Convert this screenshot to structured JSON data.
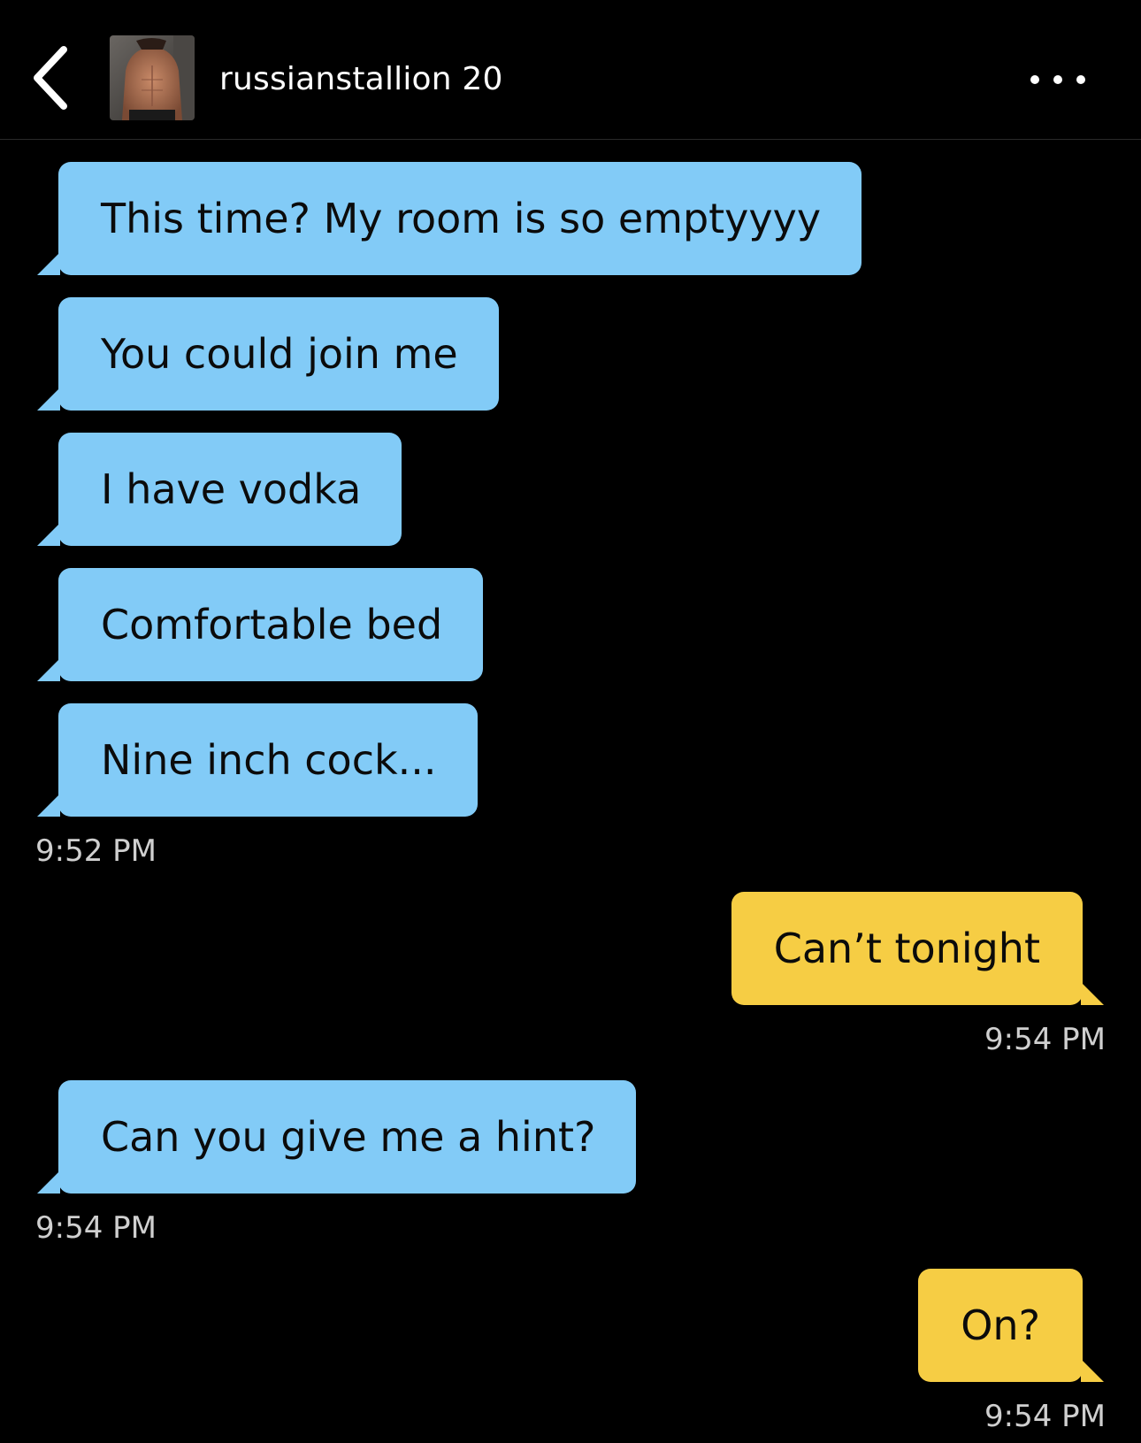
{
  "header": {
    "username": "russianstallion 20"
  },
  "colors": {
    "background": "#000000",
    "incoming_bubble": "#82cbf7",
    "outgoing_bubble": "#f6cd44",
    "timestamp": "#cfcfcf"
  },
  "icons": {
    "back": "chevron-left-icon",
    "more": "more-horizontal-icon",
    "avatar": "profile-photo"
  },
  "messages": [
    {
      "direction": "incoming",
      "text": "This time? My room is so emptyyyy"
    },
    {
      "direction": "incoming",
      "text": "You could join me"
    },
    {
      "direction": "incoming",
      "text": "I have vodka"
    },
    {
      "direction": "incoming",
      "text": "Comfortable bed"
    },
    {
      "direction": "incoming",
      "text": "Nine inch cock..."
    },
    {
      "direction": "outgoing",
      "text": "Can’t tonight"
    },
    {
      "direction": "incoming",
      "text": "Can you give me a hint?"
    },
    {
      "direction": "outgoing",
      "text": "On?"
    }
  ],
  "timestamps": [
    {
      "after_message": 5,
      "side": "left",
      "text": "9:52 PM"
    },
    {
      "after_message": 6,
      "side": "right",
      "text": "9:54 PM"
    },
    {
      "after_message": 7,
      "side": "left",
      "text": "9:54 PM"
    },
    {
      "after_message": 8,
      "side": "right",
      "text": "9:54 PM"
    }
  ]
}
